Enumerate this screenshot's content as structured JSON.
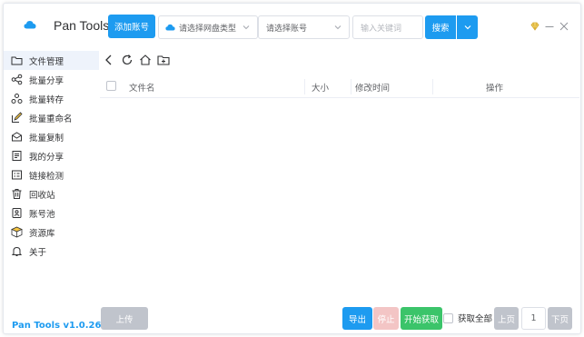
{
  "app": {
    "title": "Pan Tools",
    "version": "Pan Tools v1.0.26"
  },
  "header": {
    "add_account_label": "添加账号",
    "disk_type_placeholder": "请选择网盘类型",
    "account_placeholder": "请选择账号",
    "keyword_placeholder": "输入关键词",
    "search_label": "搜索"
  },
  "sidebar": {
    "items": [
      {
        "label": "文件管理",
        "icon": "folder-icon",
        "active": true
      },
      {
        "label": "批量分享",
        "icon": "share-icon"
      },
      {
        "label": "批量转存",
        "icon": "transfer-icon"
      },
      {
        "label": "批量重命名",
        "icon": "rename-icon"
      },
      {
        "label": "批量复制",
        "icon": "copy-icon"
      },
      {
        "label": "我的分享",
        "icon": "my-share-icon"
      },
      {
        "label": "链接检测",
        "icon": "link-check-icon"
      },
      {
        "label": "回收站",
        "icon": "trash-icon"
      },
      {
        "label": "账号池",
        "icon": "account-pool-icon"
      },
      {
        "label": "资源库",
        "icon": "resource-icon"
      },
      {
        "label": "关于",
        "icon": "bell-icon"
      }
    ]
  },
  "table": {
    "columns": [
      "文件名",
      "大小",
      "修改时间",
      "操作"
    ],
    "rows": []
  },
  "footer": {
    "upload_label": "上传",
    "export_label": "导出",
    "stop_label": "停止",
    "start_label": "开始获取",
    "fetch_all_label": "获取全部",
    "prev_label": "上页",
    "page_number": "1",
    "next_label": "下页"
  },
  "colors": {
    "accent": "#1d9bf0",
    "success": "#3bc46a",
    "disabled": "#c0c4cc",
    "danger_light": "#f3c5c5"
  }
}
